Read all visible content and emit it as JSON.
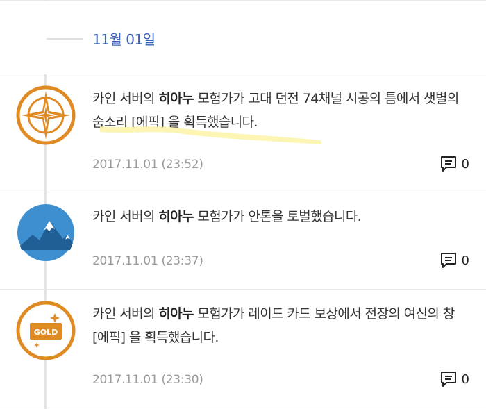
{
  "date_header": {
    "label": "11월 01일"
  },
  "entries": [
    {
      "badge_icon": "compass-star-icon",
      "server": "카인 서버의",
      "character": "히아누",
      "message_rest": "모험가가 고대 던전 74채널 시공의 틈에서 샛별의 숨소리 [에픽] 을 획득했습니다.",
      "timestamp": "2017.11.01 (23:52)",
      "comment_count": "0"
    },
    {
      "badge_icon": "mountain-icon",
      "server": "카인 서버의",
      "character": "히아누",
      "message_rest": "모험가가 안톤을 토벌했습니다.",
      "timestamp": "2017.11.01 (23:37)",
      "comment_count": "0"
    },
    {
      "badge_icon": "gold-card-icon",
      "badge_text": "GOLD",
      "server": "카인 서버의",
      "character": "히아누",
      "message_rest": "모험가가 레이드 카드 보상에서 전장의 여신의 창 [에픽] 을 획득했습니다.",
      "timestamp": "2017.11.01 (23:30)",
      "comment_count": "0"
    }
  ],
  "colors": {
    "date_blue": "#3a63b8",
    "badge_orange": "#e08a24",
    "badge_blue": "#3d8fd0",
    "highlight_yellow": "#fbf3a6"
  }
}
